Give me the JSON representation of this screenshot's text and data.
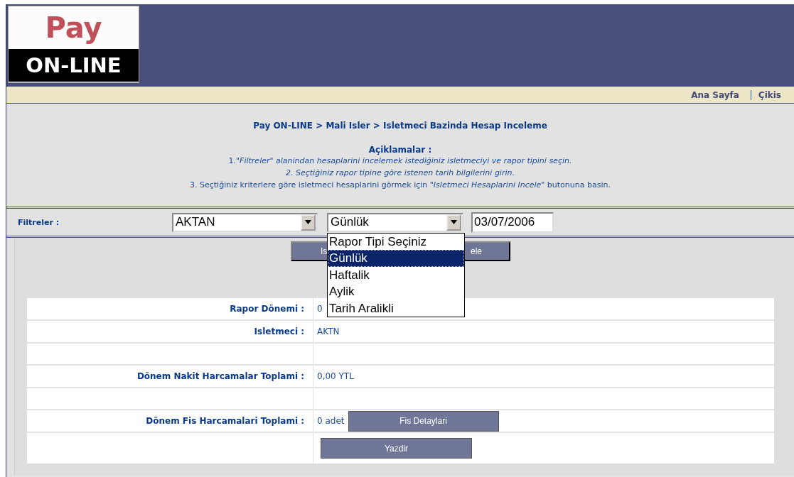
{
  "logo": {
    "top": "Pay",
    "bottom": "ON-LINE"
  },
  "top_links": [
    "Ana Sayfa",
    "Çikis"
  ],
  "breadcrumb": "Pay ON-LINE > Mali Isler > Isletmeci Bazinda Hesap Inceleme",
  "instructions": {
    "title": "Açiklamalar :",
    "lines": [
      {
        "text": "1.*\"Filtreler\" alanindan hesaplarini incelemek istediğiniz isletmeciyi ve rapor tipini seçin.*"
      },
      {
        "text": "*2. Seçtiğiniz rapor tipine göre istenen tarih bilgilerini girin.*"
      },
      {
        "text": "3. Seçtiğiniz kriterlere göre isletmeci hesaplarini görmek için *\"Isletmeci Hesaplarini Incele\"* butonuna basin."
      }
    ]
  },
  "filters": {
    "label": "Filtreler :",
    "operator": "AKTAN",
    "report_type": "Günlük",
    "date": "03/07/2006",
    "report_type_options": [
      {
        "label": "Rapor Tipi Seçiniz",
        "selected": false
      },
      {
        "label": "Günlük",
        "selected": true
      },
      {
        "label": "Haftalik",
        "selected": false
      },
      {
        "label": "Aylik",
        "selected": false
      },
      {
        "label": "Tarih Aralikli",
        "selected": false
      }
    ]
  },
  "inspect_button": {
    "left_part": "Is",
    "right_part": "ele"
  },
  "rows": [
    {
      "kind": "field",
      "label": "Rapor Dönemi :",
      "value": "0"
    },
    {
      "kind": "field",
      "label": "Isletmeci :",
      "value": "AKTN"
    },
    {
      "kind": "blank"
    },
    {
      "kind": "field",
      "label": "Dönem Nakit Harcamalar Toplami :",
      "value": "0,00 YTL"
    },
    {
      "kind": "blank"
    },
    {
      "kind": "button",
      "label": "Dönem Fis Harcamalari Toplami :",
      "value": "0 adet",
      "button": "Fis Detaylari"
    }
  ],
  "print_button": "Yazdir"
}
